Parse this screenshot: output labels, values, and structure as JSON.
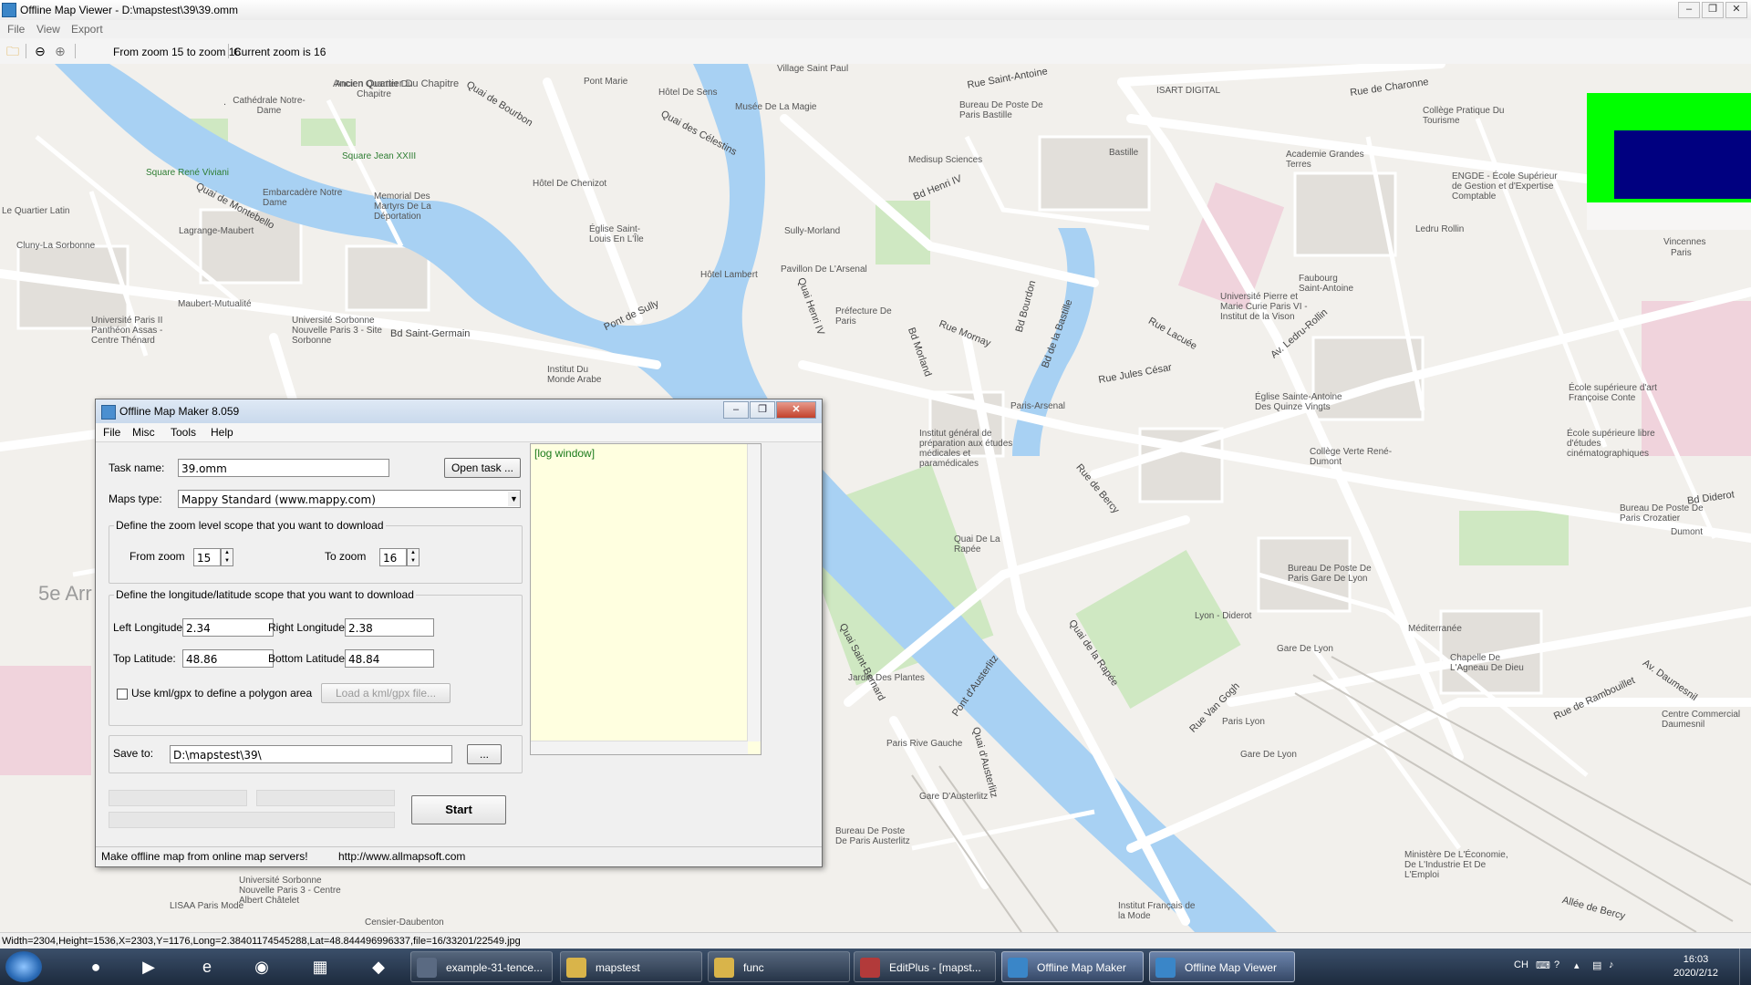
{
  "window": {
    "title": "Offline Map Viewer - D:\\mapstest\\39\\39.omm",
    "controls": [
      "–",
      "❐",
      "✕"
    ]
  },
  "menu": [
    "File",
    "View",
    "Export"
  ],
  "toolbar": {
    "zoom_range": "From zoom 15 to zoom 16",
    "current_zoom": "Current zoom is 16"
  },
  "map": {
    "labels": [
      "Ancien Quartier Du Chapitre",
      "Cathédrale Notre-Dame",
      "Square Jean XXIII",
      "Square René Viviani",
      "Quai de Montebello",
      "Quai de Bourbon",
      "Quai des Célestins",
      "Pont Marie",
      "Hôtel De Sens",
      "Musée De La Magie",
      "Village Saint Paul",
      "Rue Saint-Antoine",
      "Bureau De Poste De Paris Bastille",
      "Bastille",
      "ISART DIGITAL",
      "Rue de Charonne",
      "Collège Pratique Du Tourisme",
      "Academie Grandes Terres",
      "ENGDE - École Supérieur de Gestion et d'Expertise Comptable",
      "Ledru Rollin",
      "Medisup Sciences",
      "Bd Henri IV",
      "Sully-Morland",
      "Pavillon De L'Arsenal",
      "Église Saint-Louis En L'Île",
      "Hôtel De Chenizot",
      "Hôtel Lambert",
      "Embarcadère Notre Dame",
      "Memorial Des Martyrs De La Déportation",
      "Lagrange-Maubert",
      "Cluny-La Sorbonne",
      "Le Quartier Latin",
      "Maubert-Mutualité",
      "Université Paris II Panthéon Assas - Centre Thénard",
      "Université Sorbonne Nouvelle Paris 3 - Site Sorbonne",
      "Bd Saint-Germain",
      "Pont de Sully",
      "Institut Du Monde Arabe",
      "Préfecture De Paris",
      "Quai Henri IV",
      "Bd Morland",
      "Rue Mornay",
      "Bd Bourdon",
      "Paris-Arsenal",
      "Bd de la Bastille",
      "Rue Jules César",
      "Rue Lacuée",
      "Av. Ledru-Rollin",
      "Église Sainte-Antoine Des Quinze Vingts",
      "Université Pierre et Marie Curie Paris VI - Institut de la Vison",
      "Faubourg Saint-Antoine",
      "École supérieure d'art Françoise Conte",
      "École supérieure libre d'études cinématographiques",
      "Collège Verte René-Dumont",
      "Bureau De Poste De Paris Crozatier",
      "Bd Diderot",
      "Bureau De Poste De Paris Gare De Lyon",
      "Lyon - Diderot",
      "Gare De Lyon",
      "Méditerranée",
      "Chapelle De L'Agneau De Dieu",
      "Rue de Rambouillet",
      "Av. Daumesnil",
      "Centre Commercial Daumesnil",
      "Ministère De L'Économie, De L'Industrie Et De L'Emploi",
      "Quai de la Rapée",
      "Rue Van Gogh",
      "Paris Lyon",
      "Gare De Lyon",
      "Pont d'Austerlitz",
      "Quai d'Austerlitz",
      "Gare D'Austerlitz",
      "Paris Rive Gauche",
      "Jardin Des Plantes",
      "Quai Saint-Bernard",
      "Quai De La Rapée",
      "Institut général de préparation aux études médicales et paramédicales",
      "Bureau De Poste De Paris Austerlitz",
      "Université Sorbonne Nouvelle Paris 3 - Centre Albert Châtelet",
      "LISAA Paris Mode",
      "Censier-Daubenton",
      "Institut Français de la Mode",
      "Allée de Bercy",
      "Rue de Bercy",
      "5e Arr",
      "Vincennes",
      "Paris",
      "Dumont"
    ]
  },
  "overlay": {
    "green": "#00ff00",
    "navy": "#000080"
  },
  "statusbar": {
    "text": "Width=2304,Height=1536,X=2303,Y=1176,Long=2.38401174545288,Lat=48.844496996337,file=16/33201/22549.jpg"
  },
  "dialog": {
    "title": "Offline Map Maker 8.059",
    "menu": [
      "File",
      "Misc",
      "Tools",
      "Help"
    ],
    "task_name_label": "Task name:",
    "task_name_value": "39.omm",
    "open_task": "Open task ...",
    "maps_type_label": "Maps type:",
    "maps_type_value": "Mappy Standard (www.mappy.com)",
    "zoom_group": "Define the zoom level scope that you want to download",
    "from_zoom_label": "From zoom",
    "from_zoom_value": "15",
    "to_zoom_label": "To zoom",
    "to_zoom_value": "16",
    "lonlat_group": "Define the longitude/latitude scope that you want to download",
    "left_lon_label": "Left Longitude:",
    "left_lon_value": "2.34",
    "right_lon_label": "Right Longitude:",
    "right_lon_value": "2.38",
    "top_lat_label": "Top Latitude:",
    "top_lat_value": "48.86",
    "bottom_lat_label": "Bottom Latitude:",
    "bottom_lat_value": "48.84",
    "use_kml_label": "Use kml/gpx to define a polygon area",
    "load_kml": "Load a kml/gpx file...",
    "save_to_label": "Save to:",
    "save_to_value": "D:\\mapstest\\39\\",
    "browse": "...",
    "start": "Start",
    "log": "[log window]",
    "status_left": "Make offline map from online map servers!",
    "status_right": "http://www.allmapsoft.com"
  },
  "taskbar": {
    "tasks": [
      {
        "label": "example-31-tence...",
        "active": false,
        "color": "#5a6a82"
      },
      {
        "label": "mapstest",
        "active": false,
        "color": "#d9b44a"
      },
      {
        "label": "func",
        "active": false,
        "color": "#d9b44a"
      },
      {
        "label": "EditPlus - [mapst...",
        "active": false,
        "color": "#b23a3a"
      },
      {
        "label": "Offline Map Maker",
        "active": true,
        "color": "#3a86c8"
      },
      {
        "label": "Offline Map Viewer",
        "active": true,
        "color": "#3a86c8"
      }
    ],
    "lang": "CH",
    "time": "16:03",
    "date": "2020/2/12"
  }
}
